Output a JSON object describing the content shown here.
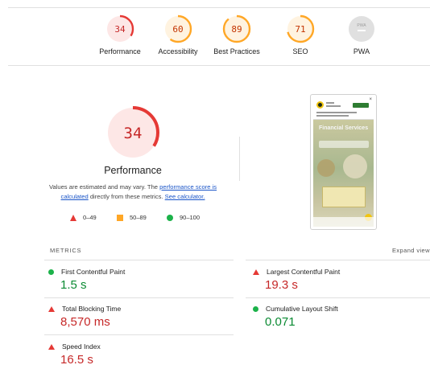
{
  "colors": {
    "fail": "#e53935",
    "fail_bg": "#fde7e6",
    "fail_text": "#c62828",
    "average": "#ffa726",
    "average_bg": "#fff3e0",
    "average_text": "#c33300",
    "pass": "#1cb24a",
    "pass_text": "#0a8a32",
    "na_bg": "#e0e0e0"
  },
  "gauges": [
    {
      "score": "34",
      "value": 34,
      "label": "Performance",
      "rating": "fail"
    },
    {
      "score": "60",
      "value": 60,
      "label": "Accessibility",
      "rating": "average"
    },
    {
      "score": "89",
      "value": 89,
      "label": "Best Practices",
      "rating": "average"
    },
    {
      "score": "71",
      "value": 71,
      "label": "SEO",
      "rating": "average"
    },
    {
      "score": "PWA",
      "value": null,
      "label": "PWA",
      "rating": "na"
    }
  ],
  "performance": {
    "score": "34",
    "value": 34,
    "title": "Performance",
    "note_prefix": "Values are estimated and may vary. The ",
    "note_link1": "performance score is calculated",
    "note_middle": " directly from these metrics. ",
    "note_link2": "See calculator."
  },
  "legend": {
    "fail": "0–49",
    "average": "50–89",
    "pass": "90–100"
  },
  "screenshot": {
    "hero_text": "Financial Services",
    "popup_icon": "app-logo-icon"
  },
  "metrics": {
    "header": "METRICS",
    "expand": "Expand view",
    "items": [
      {
        "name": "First Contentful Paint",
        "value": "1.5 s",
        "rating": "pass"
      },
      {
        "name": "Largest Contentful Paint",
        "value": "19.3 s",
        "rating": "fail"
      },
      {
        "name": "Total Blocking Time",
        "value": "8,570 ms",
        "rating": "fail"
      },
      {
        "name": "Cumulative Layout Shift",
        "value": "0.071",
        "rating": "pass"
      },
      {
        "name": "Speed Index",
        "value": "16.5 s",
        "rating": "fail"
      }
    ]
  }
}
